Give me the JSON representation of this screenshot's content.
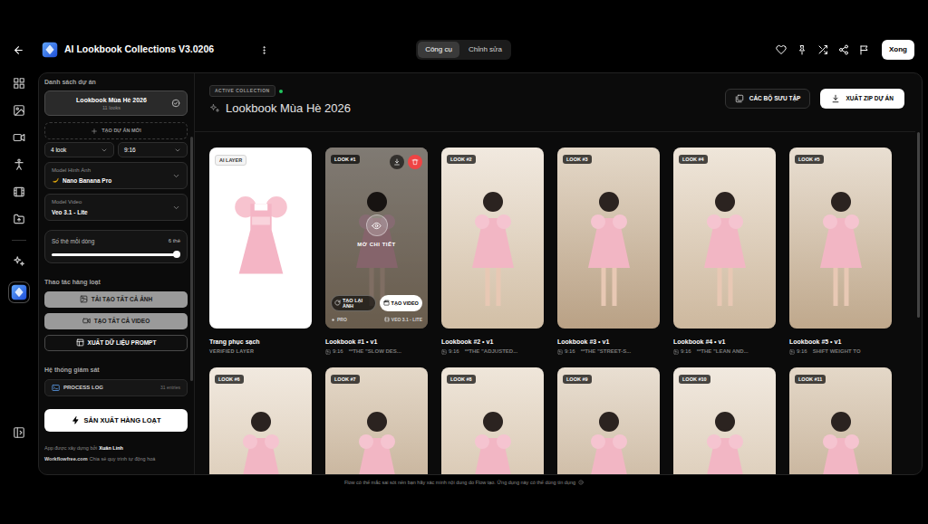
{
  "app": {
    "title": "AI Lookbook Collections V3.0206"
  },
  "tabs": [
    {
      "label": "Công cụ",
      "selected": true
    },
    {
      "label": "Chỉnh sửa",
      "selected": false
    }
  ],
  "done_button": "Xong",
  "rail": [
    {
      "kind": "dashboard",
      "selected": false
    },
    {
      "kind": "image",
      "selected": false
    },
    {
      "kind": "video",
      "selected": false
    },
    {
      "kind": "person",
      "selected": false
    },
    {
      "kind": "film",
      "selected": false
    },
    {
      "kind": "folder",
      "selected": false
    },
    {
      "kind": "sparkles",
      "selected": false
    },
    {
      "kind": "app",
      "selected": true
    },
    {
      "kind": "panel",
      "selected": false
    }
  ],
  "sidebar": {
    "projects_label": "Danh sách dự án",
    "projects": [
      {
        "name": "Lookbook Mùa Hè 2026",
        "count": "11 looks",
        "selected": true
      }
    ],
    "new_project": "TẠO DỰ ÁN MỚI",
    "look_count": "4 look",
    "aspect": "9:16",
    "image_model": {
      "label": "Model Hình Ảnh",
      "value": "Nano Banana Pro"
    },
    "video_model": {
      "label": "Model Video",
      "value": "Veo 3.1 - Lite"
    },
    "per_row": {
      "label": "Số thẻ mỗi dòng",
      "reading": "6 thẻ",
      "level": 1
    },
    "batch_label": "Thao tác hàng loạt",
    "batch_buttons": [
      {
        "label": "TẢI TẠO TẤT CẢ ẢNH",
        "kind": "image",
        "disabled": true
      },
      {
        "label": "TẠO TẤT CẢ VIDEO",
        "kind": "video",
        "disabled": true
      },
      {
        "label": "XUẤT DỮ LIỆU PROMPT",
        "kind": "table",
        "disabled": false
      }
    ],
    "monitor_label": "Hệ thống giám sát",
    "log": {
      "label": "PROCESS LOG",
      "count": "31 entries"
    },
    "produce_button": "SẢN XUẤT HÀNG LOẠT",
    "credit": {
      "prefix": "App được xây dựng bởi",
      "author": "Xuân Linh",
      "site": "Workflowfree.com",
      "tagline": "Chia sẻ quy trình tự động hoá"
    }
  },
  "collection": {
    "badge": "ACTIVE COLLECTION",
    "title": "Lookbook Mùa Hè 2026",
    "collections_button": "CÁC BỘ SƯU TẬP",
    "export_button": "XUẤT ZIP DỰ ÁN"
  },
  "cards": [
    {
      "kind": "source",
      "badge": "AI LAYER",
      "title": "Trang phục sạch",
      "subtitle": "VERIFIED LAYER"
    },
    {
      "kind": "look",
      "badge": "LOOK #1",
      "title": "Lookbook #1 • v1",
      "ratio": "9:16",
      "prompt": "**THE \"SLOW DES...",
      "hovered": true,
      "overlay": {
        "open": "MỞ CHI TIẾT",
        "regenerate": "TẠO LẠI ẢNH",
        "make_video": "TẠO VIDEO",
        "image_model": "PRO",
        "video_model": "VEO 3.1 - LITE"
      }
    },
    {
      "kind": "look",
      "badge": "LOOK #2",
      "title": "Lookbook #2 • v1",
      "ratio": "9:16",
      "prompt": "**THE \"ADJUSTED...",
      "hovered": false
    },
    {
      "kind": "look",
      "badge": "LOOK #3",
      "title": "Lookbook #3 • v1",
      "ratio": "9:16",
      "prompt": "**THE \"STREET-S...",
      "hovered": false
    },
    {
      "kind": "look",
      "badge": "LOOK #4",
      "title": "Lookbook #4 • v1",
      "ratio": "9:16",
      "prompt": "**THE \"LEAN AND...",
      "hovered": false
    },
    {
      "kind": "look",
      "badge": "LOOK #5",
      "title": "Lookbook #5 • v1",
      "ratio": "9:16",
      "prompt": "SHIFT WEIGHT TO",
      "hovered": false
    },
    {
      "kind": "look",
      "badge": "LOOK #6",
      "hovered": false
    },
    {
      "kind": "look",
      "badge": "LOOK #7",
      "hovered": false
    },
    {
      "kind": "look",
      "badge": "LOOK #8",
      "hovered": false
    },
    {
      "kind": "look",
      "badge": "LOOK #9",
      "hovered": false
    },
    {
      "kind": "look",
      "badge": "LOOK #10",
      "hovered": false
    },
    {
      "kind": "look",
      "badge": "LOOK #11",
      "hovered": false
    }
  ],
  "footer_note": "Flow có thể mắc sai sót nên bạn hãy xác minh nội dung do Flow tạo. Ứng dụng này có thể dùng tín dụng"
}
